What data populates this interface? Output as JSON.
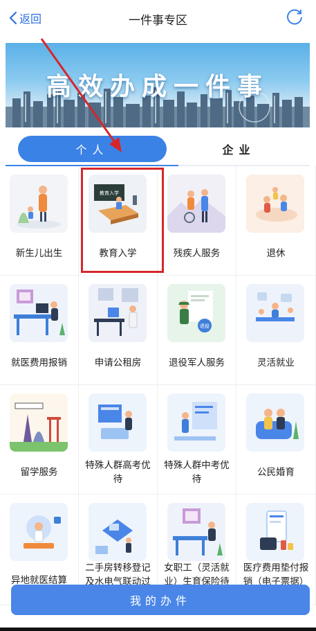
{
  "header": {
    "back_label": "返回",
    "title": "一件事专区"
  },
  "banner": {
    "title": "高效办成一件事"
  },
  "tabs": [
    {
      "label": "个人"
    },
    {
      "label": "企业"
    }
  ],
  "services": [
    {
      "label": "新生儿出生"
    },
    {
      "label": "教育入学"
    },
    {
      "label": "残疾人服务"
    },
    {
      "label": "退休"
    },
    {
      "label": "就医费用报销"
    },
    {
      "label": "申请公租房"
    },
    {
      "label": "退役军人服务"
    },
    {
      "label": "灵活就业"
    },
    {
      "label": "留学服务"
    },
    {
      "label": "特殊人群高考优待"
    },
    {
      "label": "特殊人群中考优待"
    },
    {
      "label": "公民婚育"
    },
    {
      "label": "异地就医结算"
    },
    {
      "label": "二手房转移登记及水电气联动过户"
    },
    {
      "label": "女职工（灵活就业）生育保险待遇"
    },
    {
      "label": "医疗费用垫付报销（电子票据）"
    }
  ],
  "card_art": {
    "board_text": "教育入学",
    "badge_text": "退役"
  },
  "bottom_button": {
    "label": "我的办件"
  },
  "colors": {
    "accent": "#3b82e6",
    "annotation": "#d6262c"
  }
}
